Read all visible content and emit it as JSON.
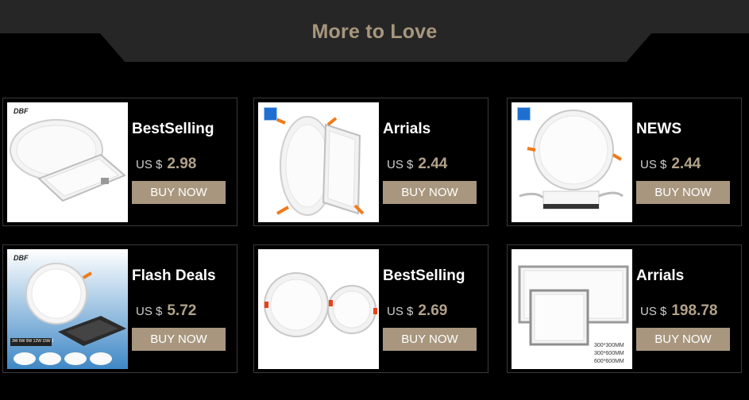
{
  "header": {
    "title": "More to Love"
  },
  "products": [
    {
      "title": "BestSelling",
      "currency": "US $",
      "price": "2.98",
      "button": "BUY NOW",
      "logo": "DBF"
    },
    {
      "title": "Arrials",
      "currency": "US $",
      "price": "2.44",
      "button": "BUY NOW"
    },
    {
      "title": "NEWS",
      "currency": "US $",
      "price": "2.44",
      "button": "BUY NOW"
    },
    {
      "title": "Flash Deals",
      "currency": "US $",
      "price": "5.72",
      "button": "BUY NOW",
      "logo": "DBF",
      "watts": "3W 6W 9W 12W 15W 18W 24W"
    },
    {
      "title": "BestSelling",
      "currency": "US $",
      "price": "2.69",
      "button": "BUY NOW"
    },
    {
      "title": "Arrials",
      "currency": "US $",
      "price": "198.78",
      "button": "BUY NOW",
      "sizes": [
        "300*300MM",
        "300*600MM",
        "600*600MM"
      ]
    }
  ],
  "colors": {
    "accent": "#a8977e",
    "background": "#000000",
    "banner": "#262626"
  }
}
